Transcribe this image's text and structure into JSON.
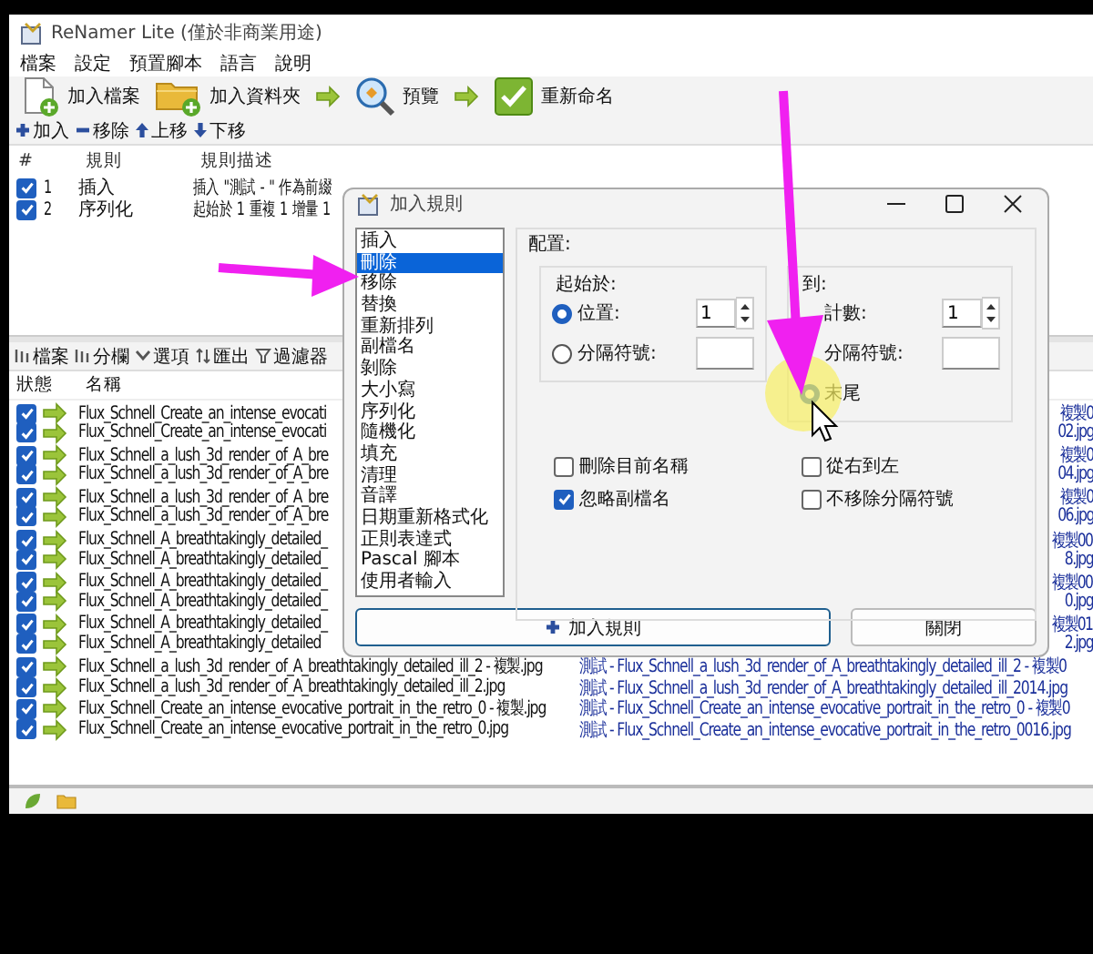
{
  "window": {
    "title": "ReNamer Lite (僅於非商業用途)"
  },
  "menu": [
    "檔案",
    "設定",
    "預置腳本",
    "語言",
    "說明"
  ],
  "toolbar": [
    {
      "kind": "add_files",
      "label": "加入檔案"
    },
    {
      "kind": "add_folder",
      "label": "加入資料夾"
    },
    {
      "kind": "arrow"
    },
    {
      "kind": "preview",
      "label": "預覽"
    },
    {
      "kind": "arrow"
    },
    {
      "kind": "rename",
      "label": "重新命名"
    }
  ],
  "rules_toolbar": [
    {
      "kind": "add",
      "label": "加入"
    },
    {
      "kind": "remove",
      "label": "移除"
    },
    {
      "kind": "up",
      "label": "上移"
    },
    {
      "kind": "down",
      "label": "下移"
    }
  ],
  "rules": {
    "columns": [
      "#",
      "規則",
      "規則描述"
    ],
    "rows": [
      {
        "checked": true,
        "number": "1",
        "rule": "插入",
        "description": "插入 \"測試 - \" 作為前綴"
      },
      {
        "checked": true,
        "number": "2",
        "rule": "序列化",
        "description": "起始於 1 重複 1 增量 1"
      }
    ]
  },
  "files": {
    "toolbar": [
      {
        "kind": "files",
        "label": "檔案"
      },
      {
        "kind": "columns",
        "label": "分欄"
      },
      {
        "kind": "options",
        "label": "選項"
      },
      {
        "kind": "export",
        "label": "匯出"
      },
      {
        "kind": "filter",
        "label": "過濾器"
      }
    ],
    "columns": [
      "狀態",
      "名稱"
    ],
    "rows": [
      {
        "kind": "covered",
        "checked": true,
        "name": "Flux_Schnell_Create_an_intense_evocati",
        "new_name": "複製0"
      },
      {
        "kind": "covered",
        "checked": true,
        "name": "Flux_Schnell_Create_an_intense_evocati",
        "new_name": "02.jpg"
      },
      {
        "kind": "covered",
        "checked": true,
        "name": "Flux_Schnell_a_lush_3d_render_of_A_bre",
        "new_name": "複製0"
      },
      {
        "kind": "covered",
        "checked": true,
        "name": "Flux_Schnell_a_lush_3d_render_of_A_bre",
        "new_name": "04.jpg"
      },
      {
        "kind": "covered",
        "checked": true,
        "name": "Flux_Schnell_a_lush_3d_render_of_A_bre",
        "new_name": "複製0"
      },
      {
        "kind": "covered",
        "checked": true,
        "name": "Flux_Schnell_a_lush_3d_render_of_A_bre",
        "new_name": "06.jpg"
      },
      {
        "kind": "covered",
        "checked": true,
        "name": "Flux_Schnell_A_breathtakingly_detailed_",
        "new_name": "複製00"
      },
      {
        "kind": "covered",
        "checked": true,
        "name": "Flux_Schnell_A_breathtakingly_detailed_",
        "new_name": "8.jpg"
      },
      {
        "kind": "covered",
        "checked": true,
        "name": "Flux_Schnell_A_breathtakingly_detailed_",
        "new_name": "複製00"
      },
      {
        "kind": "covered",
        "checked": true,
        "name": "Flux_Schnell_A_breathtakingly_detailed_",
        "new_name": "0.jpg"
      },
      {
        "kind": "covered",
        "checked": true,
        "name": "Flux_Schnell_A_breathtakingly_detailed_",
        "new_name": "複製01"
      },
      {
        "kind": "covered",
        "checked": true,
        "name": "Flux_Schnell_A_breathtakingly_detailed",
        "new_name": "2.jpg"
      },
      {
        "kind": "full",
        "checked": true,
        "name": "Flux_Schnell_a_lush_3d_render_of_A_breathtakingly_detailed_ill_2 - 複製.jpg",
        "new_name": "測試 - Flux_Schnell_a_lush_3d_render_of_A_breathtakingly_detailed_ill_2 - 複製0"
      },
      {
        "kind": "full",
        "checked": true,
        "name": "Flux_Schnell_a_lush_3d_render_of_A_breathtakingly_detailed_ill_2.jpg",
        "new_name": "測試 - Flux_Schnell_a_lush_3d_render_of_A_breathtakingly_detailed_ill_2014.jpg"
      },
      {
        "kind": "full",
        "checked": true,
        "name": "Flux_Schnell_Create_an_intense_evocative_portrait_in_the_retro_0 - 複製.jpg",
        "new_name": "測試 - Flux_Schnell_Create_an_intense_evocative_portrait_in_the_retro_0 - 複製0"
      },
      {
        "kind": "full",
        "checked": true,
        "name": "Flux_Schnell_Create_an_intense_evocative_portrait_in_the_retro_0.jpg",
        "new_name": "測試 - Flux_Schnell_Create_an_intense_evocative_portrait_in_the_retro_0016.jpg"
      }
    ]
  },
  "dialog": {
    "title": "加入規則",
    "rules": [
      {
        "label": "插入",
        "selected": false
      },
      {
        "label": "刪除",
        "selected": true
      },
      {
        "label": "移除",
        "selected": false
      },
      {
        "label": "替換",
        "selected": false
      },
      {
        "label": "重新排列",
        "selected": false
      },
      {
        "label": "副檔名",
        "selected": false
      },
      {
        "label": "剝除",
        "selected": false
      },
      {
        "label": "大小寫",
        "selected": false
      },
      {
        "label": "序列化",
        "selected": false
      },
      {
        "label": "隨機化",
        "selected": false
      },
      {
        "label": "填充",
        "selected": false
      },
      {
        "label": "清理",
        "selected": false
      },
      {
        "label": "音譯",
        "selected": false
      },
      {
        "label": "日期重新格式化",
        "selected": false
      },
      {
        "label": "正則表達式",
        "selected": false
      },
      {
        "label": "Pascal 腳本",
        "selected": false
      },
      {
        "label": "使用者輸入",
        "selected": false
      }
    ],
    "config_label": "配置:",
    "groups": [
      {
        "title": "起始於:",
        "options": [
          {
            "label": "位置:",
            "selected": true,
            "kind": "spin",
            "value": "1"
          },
          {
            "label": "分隔符號:",
            "selected": false,
            "kind": "text"
          }
        ]
      },
      {
        "title": "到:",
        "options": [
          {
            "label": "計數:",
            "kind": "spin",
            "value": "1"
          },
          {
            "label": "分隔符號:",
            "kind": "text"
          },
          {
            "label": "末尾",
            "selected": true,
            "kind": "none"
          }
        ]
      }
    ],
    "checkboxes": [
      {
        "label": "刪除目前名稱",
        "checked": false
      },
      {
        "label": "從右到左",
        "checked": false
      },
      {
        "label": "忽略副檔名",
        "checked": true
      },
      {
        "label": "不移除分隔符號",
        "checked": false
      }
    ],
    "buttons": [
      {
        "kind": "add",
        "label": "加入規則"
      },
      {
        "kind": "close",
        "label": "關閉"
      }
    ]
  }
}
